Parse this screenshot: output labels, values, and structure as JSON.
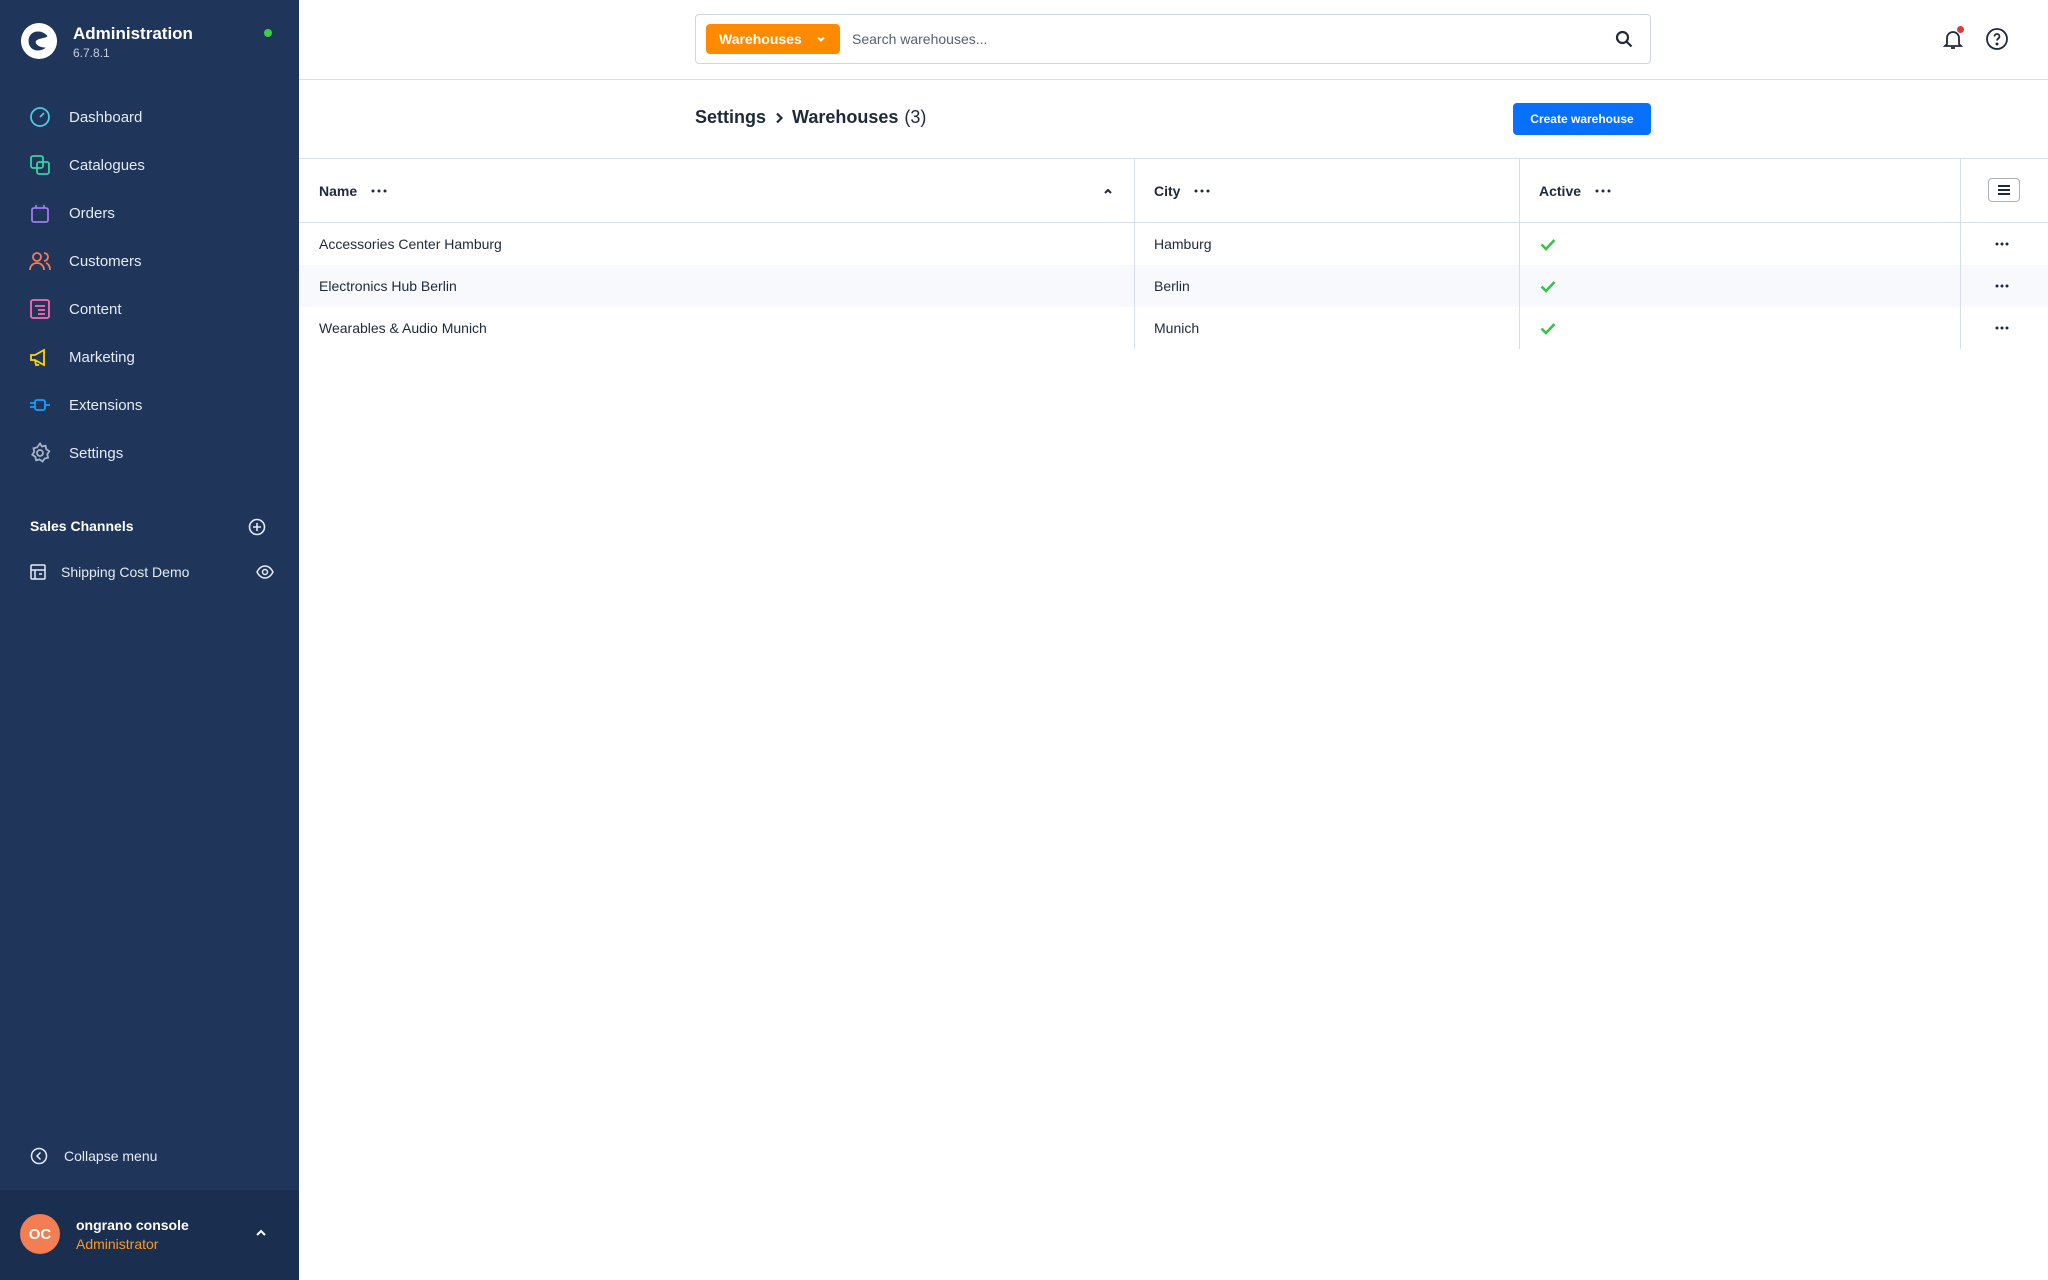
{
  "app": {
    "title": "Administration",
    "version": "6.7.8.1",
    "status_color": "#37d046"
  },
  "sidebar": {
    "items": [
      {
        "label": "Dashboard",
        "icon": "dashboard-icon",
        "color": "#4ec9e3"
      },
      {
        "label": "Catalogues",
        "icon": "catalogues-icon",
        "color": "#37d3a3"
      },
      {
        "label": "Orders",
        "icon": "orders-icon",
        "color": "#a17cf2"
      },
      {
        "label": "Customers",
        "icon": "customers-icon",
        "color": "#f87b58"
      },
      {
        "label": "Content",
        "icon": "content-icon",
        "color": "#ff68b4"
      },
      {
        "label": "Marketing",
        "icon": "marketing-icon",
        "color": "#ffd700"
      },
      {
        "label": "Extensions",
        "icon": "extensions-icon",
        "color": "#189eff"
      },
      {
        "label": "Settings",
        "icon": "settings-icon",
        "color": "#a8b4c6"
      }
    ],
    "sales_channels": {
      "title": "Sales Channels",
      "items": [
        {
          "label": "Shipping Cost Demo"
        }
      ]
    },
    "collapse_label": "Collapse menu",
    "user": {
      "initials": "OC",
      "name": "ongrano console",
      "role": "Administrator"
    }
  },
  "search": {
    "type_label": "Warehouses",
    "placeholder": "Search warehouses..."
  },
  "page": {
    "breadcrumb_parent": "Settings",
    "breadcrumb_current": "Warehouses",
    "count": "(3)",
    "create_button": "Create warehouse"
  },
  "table": {
    "columns": {
      "name": "Name",
      "city": "City",
      "active": "Active"
    },
    "rows": [
      {
        "name": "Accessories Center Hamburg",
        "city": "Hamburg",
        "active": true
      },
      {
        "name": "Electronics Hub Berlin",
        "city": "Berlin",
        "active": true
      },
      {
        "name": "Wearables & Audio Munich",
        "city": "Munich",
        "active": true
      }
    ]
  },
  "colors": {
    "accent": "#0870ff",
    "search_type": "#ff8a00",
    "sidebar_bg": "#1f355a",
    "check": "#37c24a"
  }
}
